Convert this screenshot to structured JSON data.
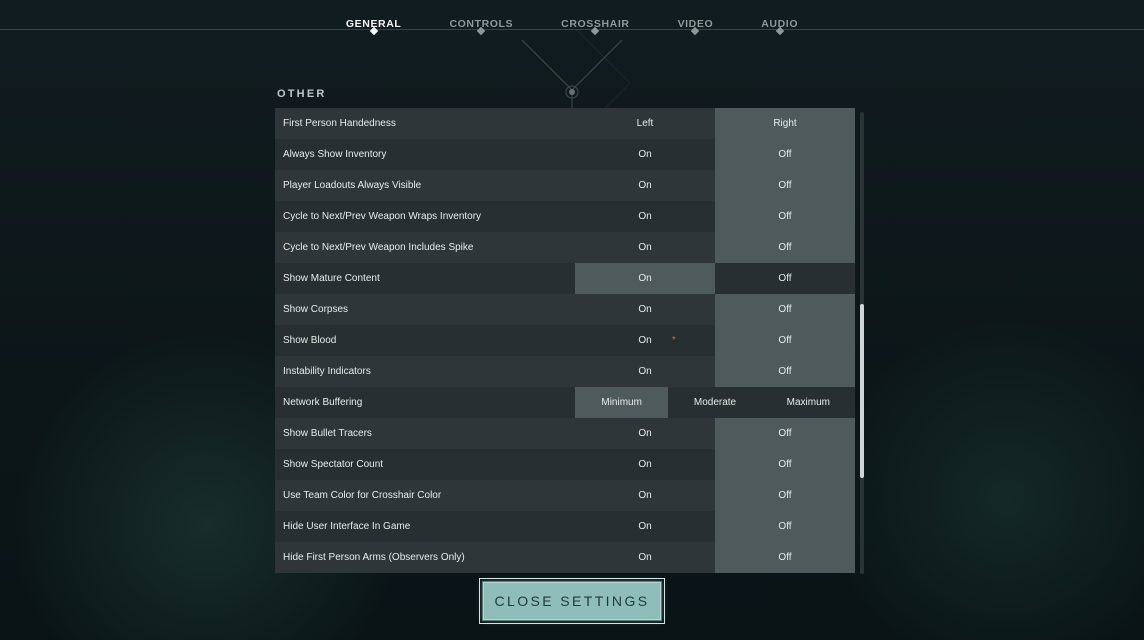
{
  "tabs": [
    {
      "label": "GENERAL",
      "active": true
    },
    {
      "label": "CONTROLS",
      "active": false
    },
    {
      "label": "CROSSHAIR",
      "active": false
    },
    {
      "label": "VIDEO",
      "active": false
    },
    {
      "label": "AUDIO",
      "active": false
    }
  ],
  "section_title": "OTHER",
  "close_label": "CLOSE SETTINGS",
  "rows": [
    {
      "label": "First Person Handedness",
      "options": [
        "Left",
        "Right"
      ],
      "selected": 1
    },
    {
      "label": "Always Show Inventory",
      "options": [
        "On",
        "Off"
      ],
      "selected": 1
    },
    {
      "label": "Player Loadouts Always Visible",
      "options": [
        "On",
        "Off"
      ],
      "selected": 1
    },
    {
      "label": "Cycle to Next/Prev Weapon Wraps Inventory",
      "options": [
        "On",
        "Off"
      ],
      "selected": 1
    },
    {
      "label": "Cycle to Next/Prev Weapon Includes Spike",
      "options": [
        "On",
        "Off"
      ],
      "selected": 1
    },
    {
      "label": "Show Mature Content",
      "options": [
        "On",
        "Off"
      ],
      "selected": 0
    },
    {
      "label": "Show Corpses",
      "options": [
        "On",
        "Off"
      ],
      "selected": 1
    },
    {
      "label": "Show Blood",
      "options": [
        "On",
        "Off"
      ],
      "selected": 1,
      "asterisk_on": 0
    },
    {
      "label": "Instability Indicators",
      "options": [
        "On",
        "Off"
      ],
      "selected": 1
    },
    {
      "label": "Network Buffering",
      "options": [
        "Minimum",
        "Moderate",
        "Maximum"
      ],
      "selected": 0
    },
    {
      "label": "Show Bullet Tracers",
      "options": [
        "On",
        "Off"
      ],
      "selected": 1
    },
    {
      "label": "Show Spectator Count",
      "options": [
        "On",
        "Off"
      ],
      "selected": 1
    },
    {
      "label": "Use Team Color for Crosshair Color",
      "options": [
        "On",
        "Off"
      ],
      "selected": 1
    },
    {
      "label": "Hide User Interface In Game",
      "options": [
        "On",
        "Off"
      ],
      "selected": 1
    },
    {
      "label": "Hide First Person Arms (Observers Only)",
      "options": [
        "On",
        "Off"
      ],
      "selected": 1
    }
  ]
}
